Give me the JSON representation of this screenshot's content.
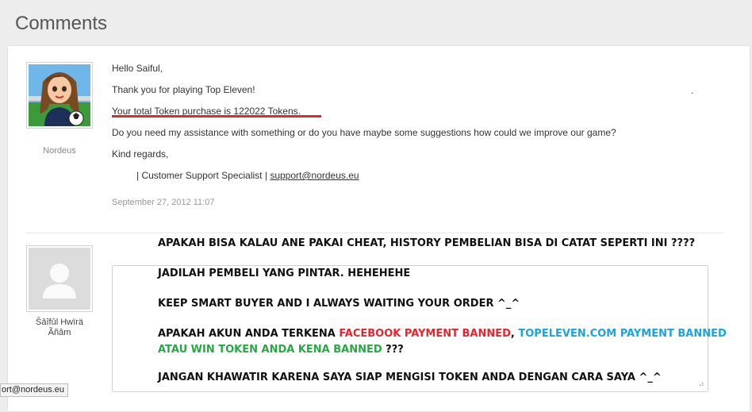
{
  "page": {
    "title": "Comments"
  },
  "comment1": {
    "author": "Nordeus",
    "greeting": "Hello Saiful,",
    "thanks": "Thank you for playing Top Eleven!",
    "token_line": "Your total Token purchase is 122022 Tokens.",
    "question": "Do you need my assistance with something or do you have maybe some suggestions how could we improve our game?",
    "closing": "Kind regards,",
    "signature_prefix": "| Customer Support Specialist |",
    "signature_email": "support@nordeus.eu",
    "date": "September 27, 2012 11:07",
    "stray_mark": "."
  },
  "comment2": {
    "author": "Šâîfûl Hwïrä Ãñâm",
    "question_line": "APAKAH BISA KALAU ANE PAKAI CHEAT, HISTORY PEMBELIAN BISA DI CATAT SEPERTI INI ????"
  },
  "reply_box": {
    "line1": "JADILAH PEMBELI YANG PINTAR. HEHEHEHE",
    "line2": "KEEP SMART BUYER AND I ALWAYS WAITING YOUR ORDER ^_^",
    "line3_a": "APAKAH AKUN ANDA TERKENA ",
    "line3_b": "FACEBOOK PAYMENT BANNED",
    "line3_c": ", ",
    "line3_d": "TOPELEVEN.COM PAYMENT  BANNED",
    "line4_a": "ATAU WIN TOKEN ANDA KENA BANNED",
    "line4_b": " ???",
    "line5": "JANGAN KHAWATIR KARENA SAYA SIAP MENGISI TOKEN ANDA DENGAN CARA SAYA ^_^",
    "resize_grip": "⠴"
  },
  "tooltip": {
    "text": "ort@nordeus.eu"
  },
  "colors": {
    "red_text": "#e8242c",
    "blue_text": "#1aa3e0",
    "green_text": "#28a745",
    "underline": "#e8242c"
  },
  "icons": {
    "avatar1": "cartoon-girl-avatar-icon",
    "avatar2": "default-user-silhouette-icon"
  }
}
